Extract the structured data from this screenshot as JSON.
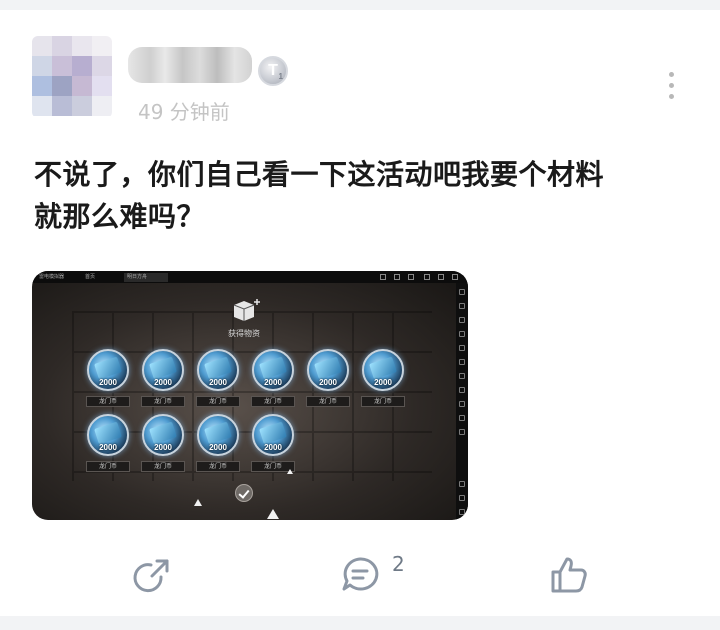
{
  "post": {
    "time": "49 分钟前",
    "badge_letter": "T",
    "badge_sub": "1",
    "text_line1": "不说了，你们自己看一下这活动吧我要个材料",
    "text_line2": "就那么难吗？"
  },
  "screenshot": {
    "tabs": [
      "雷电模拟器",
      "首页",
      "明日方舟"
    ],
    "dialog_title": "获得物资",
    "items": [
      {
        "amount": "2000",
        "label": "龙门币"
      },
      {
        "amount": "2000",
        "label": "龙门币"
      },
      {
        "amount": "2000",
        "label": "龙门币"
      },
      {
        "amount": "2000",
        "label": "龙门币"
      },
      {
        "amount": "2000",
        "label": "龙门币"
      },
      {
        "amount": "2000",
        "label": "龙门币"
      },
      {
        "amount": "2000",
        "label": "龙门币"
      },
      {
        "amount": "2000",
        "label": "龙门币"
      },
      {
        "amount": "2000",
        "label": "龙门币"
      },
      {
        "amount": "2000",
        "label": "龙门币"
      }
    ]
  },
  "actions": {
    "share_icon": "share-icon",
    "comment_icon": "comment-icon",
    "comment_count": "2",
    "like_icon": "thumbs-up-icon"
  },
  "colors": {
    "accent_icon": "#8d97a5",
    "text": "#1a1a1a",
    "muted": "#c4c4c4"
  }
}
